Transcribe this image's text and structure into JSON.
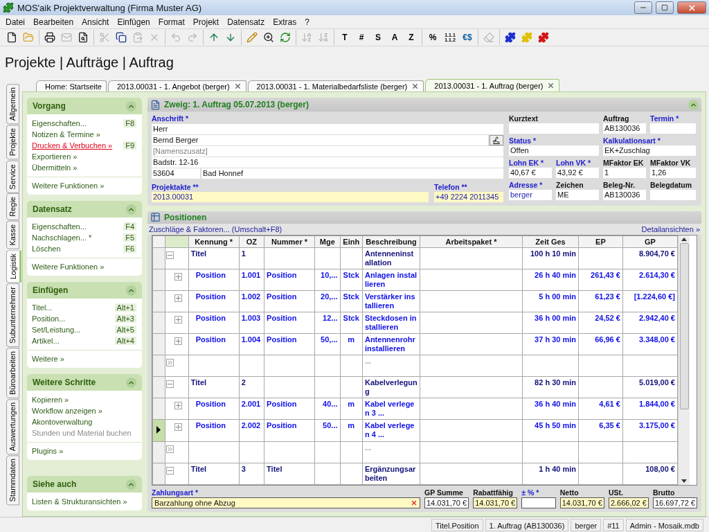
{
  "window": {
    "title": "MOS'aik Projektverwaltung (Firma Muster AG)"
  },
  "menu": [
    "Datei",
    "Bearbeiten",
    "Ansicht",
    "Einfügen",
    "Format",
    "Projekt",
    "Datensatz",
    "Extras",
    "?"
  ],
  "toolbar_groups": [
    [
      {
        "disabled": false
      },
      {
        "disabled": false
      }
    ],
    [
      {
        "disabled": false
      },
      {
        "disabled": true
      },
      {
        "disabled": false
      }
    ],
    [
      {
        "disabled": true
      },
      {
        "disabled": false
      },
      {
        "disabled": true
      },
      {
        "disabled": true
      }
    ],
    [
      {
        "disabled": true
      },
      {
        "disabled": true
      }
    ],
    [
      {
        "disabled": false
      },
      {
        "disabled": false
      }
    ],
    [
      {
        "disabled": false
      },
      {
        "disabled": false
      },
      {
        "disabled": false
      }
    ],
    [
      {
        "disabled": true
      },
      {
        "disabled": true
      }
    ],
    [
      {
        "label": "T",
        "disabled": false
      },
      {
        "label": "#",
        "disabled": false
      },
      {
        "label": "S",
        "disabled": false
      },
      {
        "label": "A",
        "disabled": false
      },
      {
        "label": "Z",
        "disabled": false
      }
    ],
    [
      {
        "label": "%",
        "disabled": false
      },
      {
        "label": "1.1.1 1.1.2",
        "disabled": false
      },
      {
        "label": "€$",
        "disabled": false
      }
    ],
    [
      {
        "disabled": true
      }
    ],
    [
      {
        "disabled": false
      },
      {
        "disabled": false
      },
      {
        "disabled": false
      }
    ]
  ],
  "breadcrumb": "Projekte | Aufträge | Auftrag",
  "side_tabs": [
    {
      "label": "Allgemein",
      "selected": false
    },
    {
      "label": "Projekte",
      "selected": false
    },
    {
      "label": "Service",
      "selected": false
    },
    {
      "label": "Regie",
      "selected": false
    },
    {
      "label": "Kasse",
      "selected": false
    },
    {
      "label": "Logistik",
      "selected": true
    },
    {
      "label": "Subunternehmer",
      "selected": false
    },
    {
      "label": "Büroarbeiten",
      "selected": false
    },
    {
      "label": "Auswertungen",
      "selected": false
    },
    {
      "label": "Stammdaten",
      "selected": false
    }
  ],
  "doc_tabs": [
    {
      "label": "Home: Startseite",
      "closable": false,
      "selected": false
    },
    {
      "label": "2013.00031 - 1. Angebot (berger)",
      "closable": true,
      "selected": false
    },
    {
      "label": "2013.00031 - 1. Materialbedarfsliste (berger)",
      "closable": true,
      "selected": false
    },
    {
      "label": "2013.00031 - 1. Auftrag (berger)",
      "closable": true,
      "selected": true
    }
  ],
  "sidebar": [
    {
      "title": "Vorgang",
      "items": [
        {
          "label": "Eigenschaften...",
          "shortcut": "F8",
          "kind": "normal"
        },
        {
          "label": "Notizen & Termine »",
          "kind": "normal"
        },
        {
          "label": "Drucken & Verbuchen »",
          "shortcut": "F9",
          "kind": "hover"
        },
        {
          "label": "Exportieren »",
          "kind": "normal"
        },
        {
          "label": "Übermitteln »",
          "kind": "normal"
        }
      ],
      "footer": "Weitere Funktionen »"
    },
    {
      "title": "Datensatz",
      "items": [
        {
          "label": "Eigenschaften...",
          "shortcut": "F4",
          "kind": "normal"
        },
        {
          "label": "Nachschlagen... *",
          "shortcut": "F5",
          "kind": "normal"
        },
        {
          "label": "Löschen",
          "shortcut": "F6",
          "kind": "normal"
        }
      ],
      "footer": "Weitere Funktionen »"
    },
    {
      "title": "Einfügen",
      "items": [
        {
          "label": "Titel...",
          "shortcut": "Alt+1",
          "kind": "normal"
        },
        {
          "label": "Position...",
          "shortcut": "Alt+3",
          "kind": "normal"
        },
        {
          "label": "Set/Leistung...",
          "shortcut": "Alt+5",
          "kind": "normal"
        },
        {
          "label": "Artikel...",
          "shortcut": "Alt+4",
          "kind": "normal"
        }
      ],
      "footer": "Weitere »"
    },
    {
      "title": "Weitere Schritte",
      "items": [
        {
          "label": "Kopieren »",
          "kind": "normal"
        },
        {
          "label": "Workflow anzeigen »",
          "kind": "normal"
        },
        {
          "label": "Akontoverwaltung",
          "kind": "normal"
        },
        {
          "label": "Stunden und Material buchen",
          "kind": "disabled"
        }
      ],
      "footer": "Plugins »"
    },
    {
      "title": "Siehe auch",
      "items": [
        {
          "label": "Listen & Strukturansichten »",
          "kind": "normal"
        }
      ]
    }
  ],
  "document": {
    "title": "Zweig: 1. Auftrag 05.07.2013 (berger)",
    "address": {
      "label": "Anschrift *",
      "required": true,
      "lines": [
        {
          "value": "Herr"
        },
        {
          "value": "Bernd Berger",
          "button": true
        },
        {
          "placeholder": "[Namenszusatz]"
        },
        {
          "value": "Badstr. 12-16"
        },
        {
          "postal": "53604",
          "city": "Bad Honnef"
        }
      ]
    },
    "left_fields": [
      {
        "label": "Projektakte **",
        "required": true,
        "value": "2013.00031",
        "highlighted": true,
        "linked": true
      },
      {
        "label": "Telefon **",
        "required": true,
        "value": "+49 2224 2011345",
        "highlighted": true,
        "linked": true
      }
    ],
    "fields": [
      {
        "label": "Kurztext",
        "required": false,
        "highlighted": false
      },
      {
        "label": "Auftrag",
        "required": false,
        "value": "AB130036",
        "highlighted": false,
        "linked": false
      },
      {
        "label": "Termin *",
        "required": true,
        "highlighted": false
      },
      {
        "label": "Status *",
        "required": true,
        "value": "Offen",
        "highlighted": false,
        "linked": false
      },
      {
        "label": "Kalkulationsart *",
        "required": true,
        "value": "EK+Zuschlag",
        "highlighted": false,
        "linked": false
      },
      {
        "label": "Lohn EK *",
        "required": true,
        "value": "40,67 €",
        "highlighted": false,
        "linked": false
      },
      {
        "label": "Lohn VK *",
        "required": true,
        "value": "43,92 €",
        "highlighted": false,
        "linked": false
      },
      {
        "label": "MFaktor EK",
        "required": false,
        "value": "1",
        "highlighted": false,
        "linked": false
      },
      {
        "label": "MFaktor VK",
        "required": false,
        "value": "1,26",
        "highlighted": false,
        "linked": false
      },
      {
        "label": "Adresse *",
        "required": true,
        "value": "berger",
        "highlighted": false,
        "linked": true
      },
      {
        "label": "Zeichen",
        "required": false,
        "value": "ME",
        "highlighted": false,
        "linked": false
      },
      {
        "label": "Beleg-Nr.",
        "required": false,
        "value": "AB130036",
        "highlighted": false,
        "linked": false
      },
      {
        "label": "Belegdatum",
        "required": false,
        "highlighted": false
      }
    ]
  },
  "positions": {
    "title": "Positionen",
    "action": "Zuschläge & Faktoren... (Umschalt+F8)",
    "details": "Detailansichten »",
    "columns": [
      "Kennung *",
      "OZ",
      "Nummer *",
      "Mge",
      "Einh",
      "Beschreibung",
      "Arbeitspaket *",
      "Zeit Ges",
      "EP",
      "GP"
    ],
    "rows": [
      {
        "kind": "title",
        "expanded": true,
        "selected": false,
        "kennung": "Titel",
        "oz": "1",
        "beschreibung": "Antenneninstallation",
        "zeit": "100 h 10 min",
        "gp": "8.904,70 €"
      },
      {
        "kind": "position",
        "expanded": false,
        "selected": false,
        "kennung": "Position",
        "oz": "1.001",
        "nummer": "Position",
        "mge": "10,...",
        "einh": "Stck",
        "beschreibung": "Anlagen installieren",
        "zeit": "26 h 40 min",
        "ep": "261,43 €",
        "gp": "2.614,30 €"
      },
      {
        "kind": "position",
        "expanded": false,
        "selected": false,
        "kennung": "Position",
        "oz": "1.002",
        "nummer": "Position",
        "mge": "20,...",
        "einh": "Stck",
        "beschreibung": "Verstärker installieren",
        "zeit": "5 h 00 min",
        "ep": "61,23 €",
        "gp": "[1.224,60 €]"
      },
      {
        "kind": "position",
        "expanded": false,
        "selected": false,
        "kennung": "Position",
        "oz": "1.003",
        "nummer": "Position",
        "mge": "12...",
        "einh": "Stck",
        "beschreibung": "Steckdosen installieren",
        "zeit": "36 h 00 min",
        "ep": "24,52 €",
        "gp": "2.942,40 €"
      },
      {
        "kind": "position",
        "expanded": false,
        "selected": false,
        "kennung": "Position",
        "oz": "1.004",
        "nummer": "Position",
        "mge": "50,...",
        "einh": "m",
        "beschreibung": "Antennenrohr installieren",
        "zeit": "37 h 30 min",
        "ep": "66,96 €",
        "gp": "3.348,00 €"
      },
      {
        "kind": "new",
        "selected": false,
        "beschreibung": "..."
      },
      {
        "kind": "title",
        "expanded": true,
        "selected": false,
        "kennung": "Titel",
        "oz": "2",
        "beschreibung": "Kabelverlegung",
        "zeit": "82 h 30 min",
        "gp": "5.019,00 €"
      },
      {
        "kind": "position",
        "expanded": false,
        "selected": false,
        "kennung": "Position",
        "oz": "2.001",
        "nummer": "Position",
        "mge": "40...",
        "einh": "m",
        "beschreibung": "Kabel verlegen 3 ...",
        "zeit": "36 h 40 min",
        "ep": "4,61 €",
        "gp": "1.844,00 €"
      },
      {
        "kind": "position",
        "expanded": false,
        "selected": true,
        "kennung": "Position",
        "oz": "2.002",
        "nummer": "Position",
        "mge": "50...",
        "einh": "m",
        "beschreibung": "Kabel verlegen 4 ...",
        "zeit": "45 h 50 min",
        "ep": "6,35 €",
        "gp": "3.175,00 €"
      },
      {
        "kind": "new",
        "selected": false,
        "beschreibung": "..."
      },
      {
        "kind": "title",
        "expanded": true,
        "selected": false,
        "kennung": "Titel",
        "oz": "3",
        "nummer": "Titel",
        "beschreibung": "Ergänzungsarbeiten",
        "zeit": "1 h 40 min",
        "gp": "108,00 €"
      }
    ],
    "payment": {
      "label": "Zahlungsart *",
      "required": true,
      "value": "Barzahlung ohne Abzug",
      "highlighted": true
    },
    "totals": [
      {
        "label": "GP Summe",
        "required": false,
        "value": "14.031,70 €",
        "highlighted": false
      },
      {
        "label": "Rabattfähig",
        "required": false,
        "value": "14.031,70 €",
        "highlighted": true
      },
      {
        "label": "± % *",
        "required": true,
        "highlighted": false
      },
      {
        "label": "Netto",
        "required": false,
        "value": "14.031,70 €",
        "highlighted": true
      },
      {
        "label": "USt.",
        "required": false,
        "value": "2.666,02 €",
        "highlighted": true
      },
      {
        "label": "Brutto",
        "required": false,
        "value": "16.697,72 €",
        "highlighted": false
      }
    ]
  },
  "status_bar": [
    "Titel.Position",
    "1. Auftrag (AB130036)",
    "berger",
    "#11",
    "Admin - Mosaik.mdb"
  ]
}
